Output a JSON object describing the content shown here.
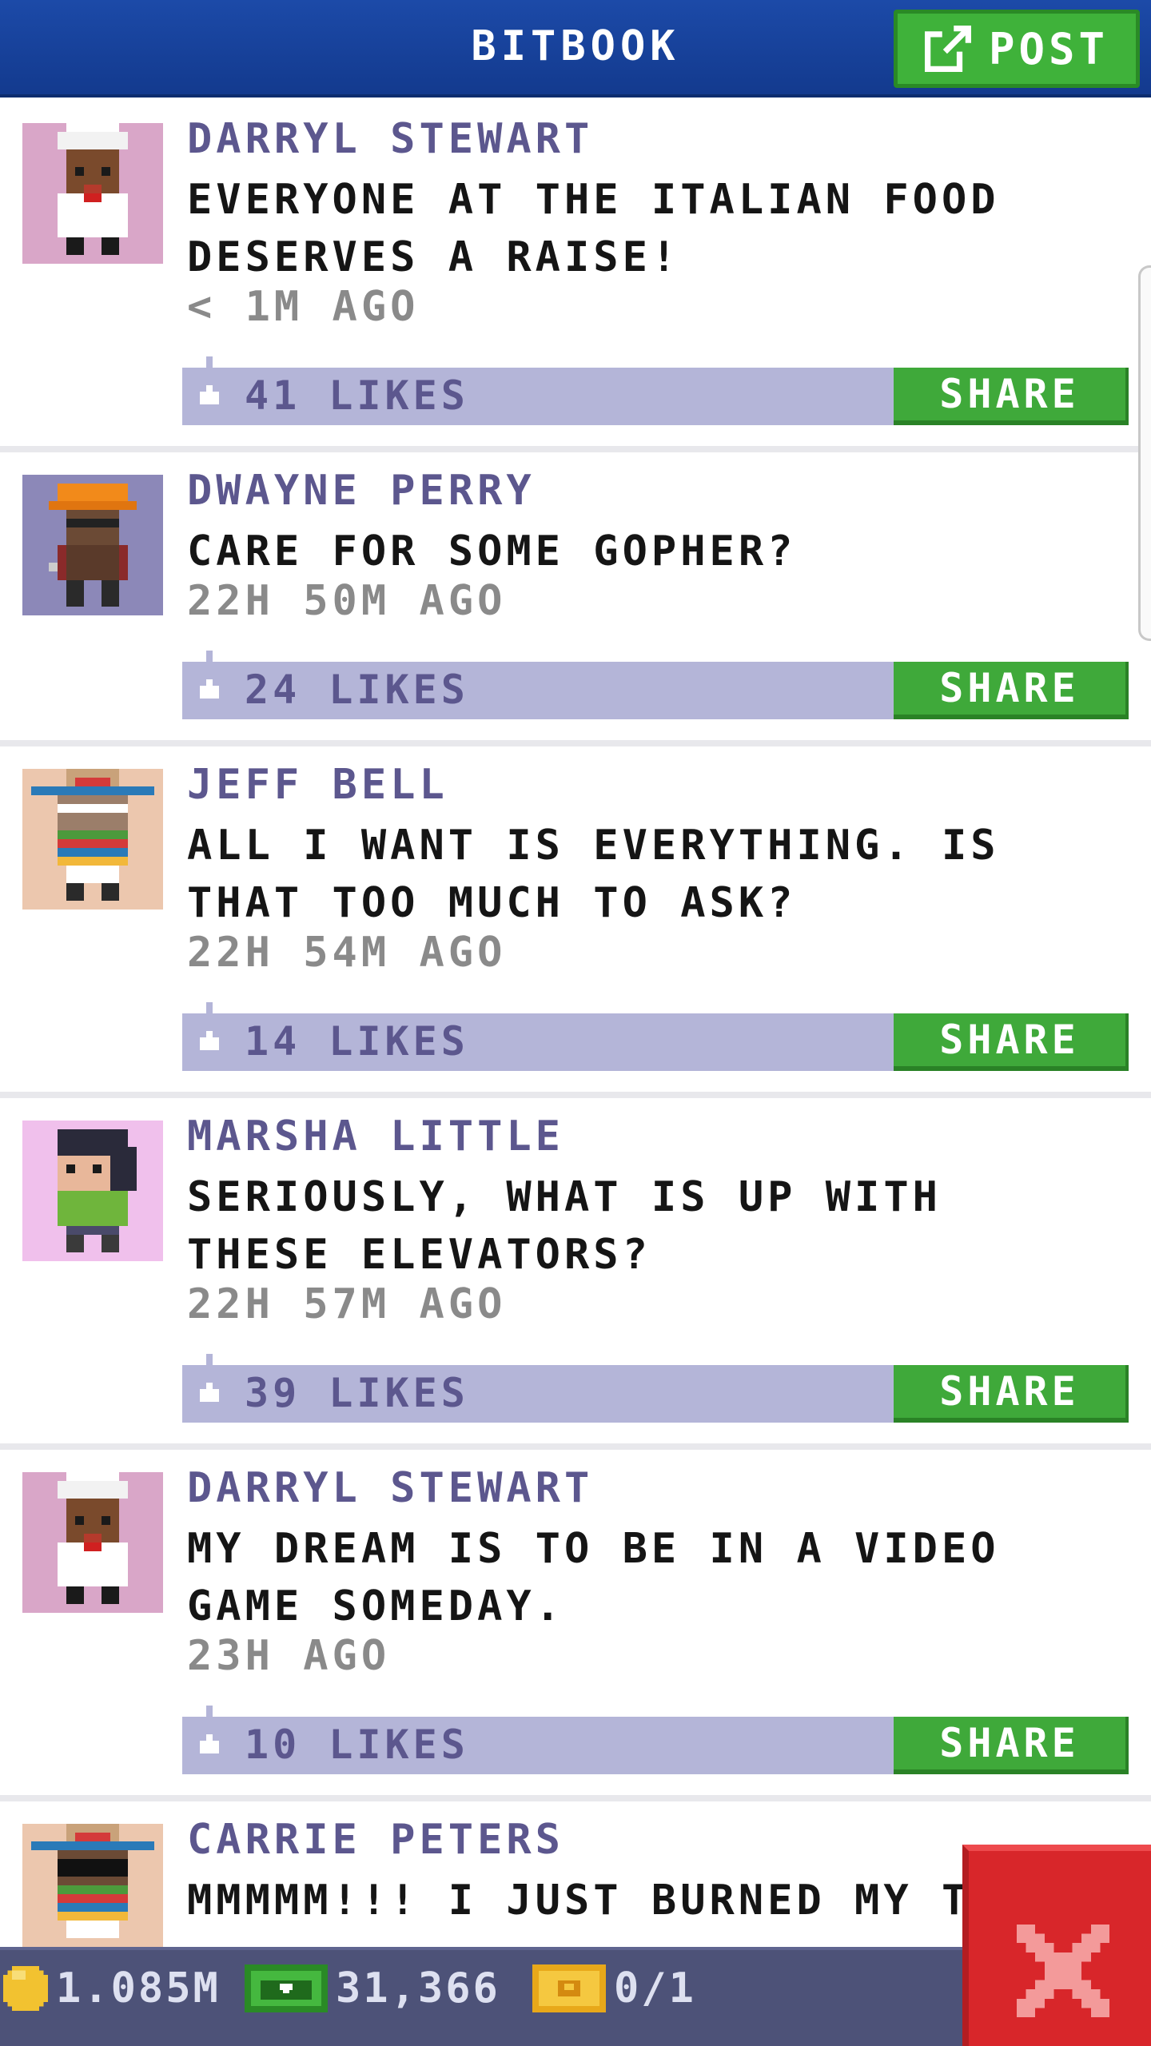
{
  "header": {
    "title": "BITBOOK",
    "post_label": "POST"
  },
  "colors": {
    "header_blue": "#1c4aa8",
    "accent_green": "#3fb23a",
    "author_purple": "#5c578e",
    "like_bar": "#b4b5d8",
    "close_red": "#d8262a"
  },
  "posts": [
    {
      "author": "DARRYL STEWART",
      "message": "EVERYONE AT THE ITALIAN FOOD DESERVES A RAISE!",
      "time": "< 1M AGO",
      "likes": "41 LIKES",
      "share": "SHARE",
      "avatar": "chef-avatar"
    },
    {
      "author": "DWAYNE PERRY",
      "message": "CARE FOR SOME GOPHER?",
      "time": "22H 50M AGO",
      "likes": "24 LIKES",
      "share": "SHARE",
      "avatar": "hardhat-avatar"
    },
    {
      "author": "JEFF BELL",
      "message": "ALL I WANT IS EVERYTHING. IS THAT TOO MUCH TO ASK?",
      "time": "22H 54M AGO",
      "likes": "14 LIKES",
      "share": "SHARE",
      "avatar": "sombrero-avatar"
    },
    {
      "author": "MARSHA LITTLE",
      "message": "SERIOUSLY, WHAT IS UP WITH THESE ELEVATORS?",
      "time": "22H 57M AGO",
      "likes": "39 LIKES",
      "share": "SHARE",
      "avatar": "woman-avatar"
    },
    {
      "author": "DARRYL STEWART",
      "message": "MY DREAM IS TO BE IN A VIDEO GAME SOMEDAY.",
      "time": "23H AGO",
      "likes": "10 LIKES",
      "share": "SHARE",
      "avatar": "chef-avatar"
    },
    {
      "author": "CARRIE PETERS",
      "message": "MMMMM!!! I JUST BURNED MY TO",
      "time": "",
      "likes": "",
      "share": "",
      "avatar": "sombrero-sunglasses-avatar"
    }
  ],
  "status": {
    "coins": "1.085M",
    "bux": "31,366",
    "tickets": "0/1"
  },
  "close_icon": "close-x-icon"
}
